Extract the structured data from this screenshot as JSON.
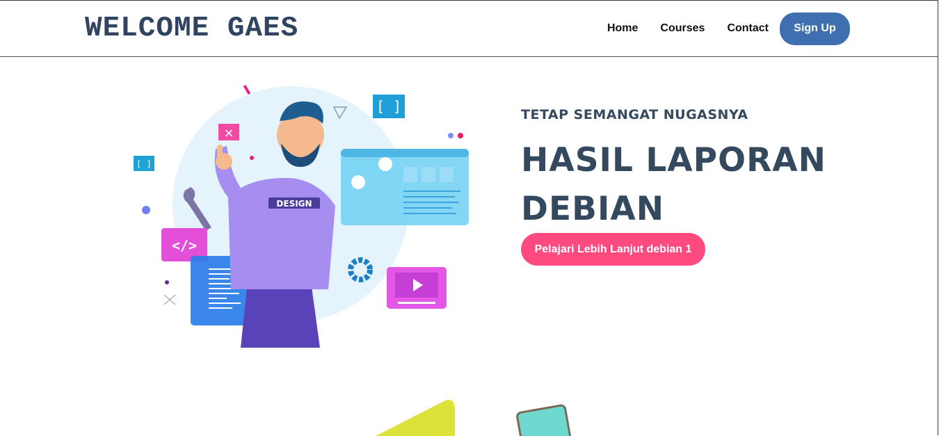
{
  "header": {
    "brand": "WELCOME GAES",
    "nav": [
      "Home",
      "Courses",
      "Contact"
    ],
    "signup_label": "Sign Up"
  },
  "hero": {
    "kicker": "TETAP SEMANGAT NUGASNYA",
    "title": "HASIL LAPORAN DEBIAN",
    "cta_label": "Pelajari Lebih Lanjut debian 1",
    "illustration_badge": "DESIGN"
  },
  "colors": {
    "accent": "#3f6faf",
    "cta": "#fd4b7f",
    "heading": "#34495e"
  }
}
